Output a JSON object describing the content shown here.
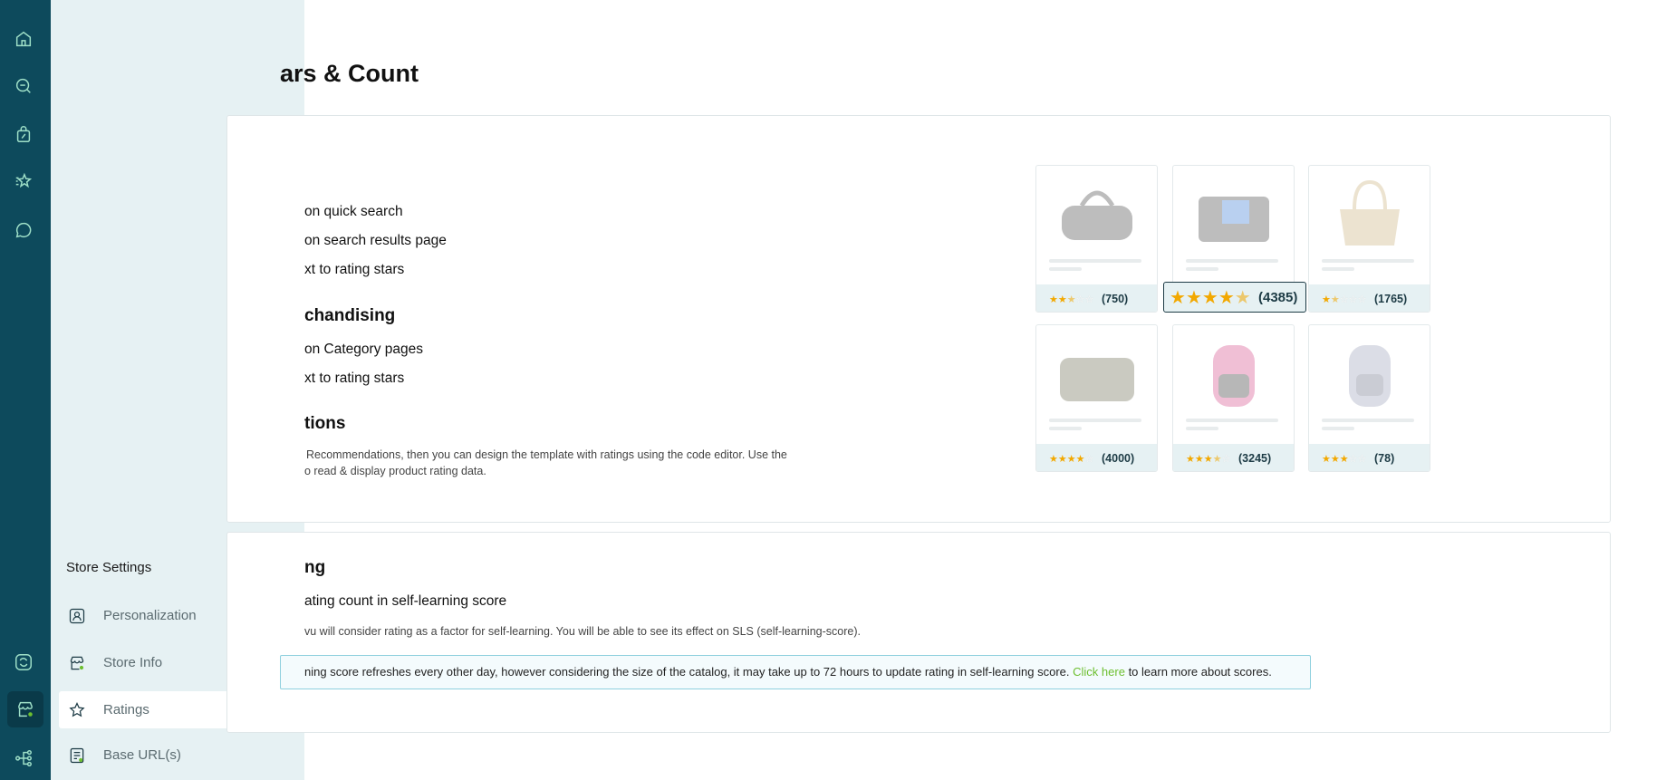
{
  "rail": {
    "top_icons": [
      "home-icon",
      "search-refresh-icon",
      "shopping-bag-icon",
      "star-sparkle-icon",
      "chat-icon"
    ],
    "bottom_icons": [
      "sync-icon",
      "store-settings-icon",
      "workflow-icon"
    ]
  },
  "drawer": {
    "title": "Store Settings",
    "items": [
      {
        "label": "Personalization",
        "icon": "personalization-icon"
      },
      {
        "label": "Store Info",
        "icon": "store-info-icon"
      },
      {
        "label": "Ratings",
        "icon": "star-icon",
        "active": true
      },
      {
        "label": "Base URL(s)",
        "icon": "base-url-icon"
      }
    ]
  },
  "page": {
    "title": "ars & Count",
    "section1": {
      "opt1": "on quick search",
      "opt2": "on search results page",
      "opt3": "xt to rating stars",
      "heading2": "chandising",
      "opt4": "on Category pages",
      "opt5": "xt to rating stars",
      "heading3": "tions",
      "desc1": "Recommendations, then you can design the template with ratings using the code editor. Use the",
      "desc2": "o read & display product rating data."
    },
    "section2": {
      "heading": "ng",
      "opt": "ating count in self-learning score",
      "desc": "vu will consider rating as a factor for self-learning. You will be able to see its effect on SLS (self-learning-score).",
      "info_text": "ning score refreshes every other day, however considering the size of the catalog, it may take up to 72 hours to update rating in self-learning score.",
      "info_link": "Click here",
      "info_tail": "to learn more about scores."
    }
  },
  "products": [
    {
      "stars": "★★½☆☆",
      "count": "(750)",
      "image": "duffel-bag"
    },
    {
      "stars": "★★★★½",
      "count": "(4385)",
      "image": "messenger-bag",
      "highlighted": true
    },
    {
      "stars": "★½☆☆☆",
      "count": "(1765)",
      "image": "tote-bag"
    },
    {
      "stars": "★★★★☆",
      "count": "(4000)",
      "image": "messenger-bag-2"
    },
    {
      "stars": "★★★½☆",
      "count": "(3245)",
      "image": "backpack-pink"
    },
    {
      "stars": "★★★☆☆",
      "count": "(78)",
      "image": "backpack-white"
    }
  ],
  "colors": {
    "rail": "#0d4a5c",
    "drawer": "#e6f1f3",
    "star": "#f2a800",
    "link": "#6dbf2f"
  }
}
